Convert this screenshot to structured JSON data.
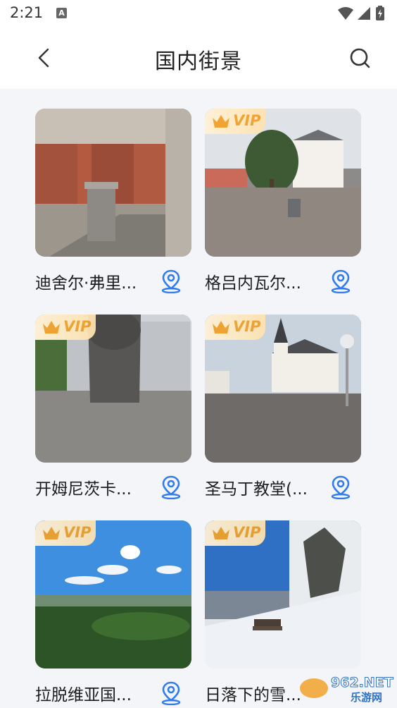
{
  "status": {
    "time": "2:21",
    "app_badge": "A"
  },
  "header": {
    "title": "国内街景"
  },
  "icons": {
    "back": "back-arrow-icon",
    "search": "search-icon",
    "location": "location-pin-icon",
    "crown": "crown-icon"
  },
  "colors": {
    "accent_blue": "#2f7bf0",
    "vip_gold": "#f0a12a",
    "background": "#f4f5f8"
  },
  "cards": [
    {
      "title": "迪舍尔·弗里...",
      "vip": false,
      "scene": "stone memorial hall interior"
    },
    {
      "title": "格吕内瓦尔...",
      "vip": true,
      "vip_label": "VIP",
      "scene": "village square with white house"
    },
    {
      "title": "开姆尼茨卡...",
      "vip": true,
      "vip_label": "VIP",
      "scene": "monument plaza with high-rise"
    },
    {
      "title": "圣马丁教堂(...",
      "vip": true,
      "vip_label": "VIP",
      "scene": "white church with steeple"
    },
    {
      "title": "拉脱维亚国...",
      "vip": true,
      "vip_label": "VIP",
      "scene": "forest under blue sky"
    },
    {
      "title": "日落下的雪...",
      "vip": true,
      "vip_label": "VIP",
      "scene": "snowy hillside with bench"
    }
  ],
  "watermark": {
    "text_top": "962.NET",
    "text_bottom": "乐游网"
  }
}
